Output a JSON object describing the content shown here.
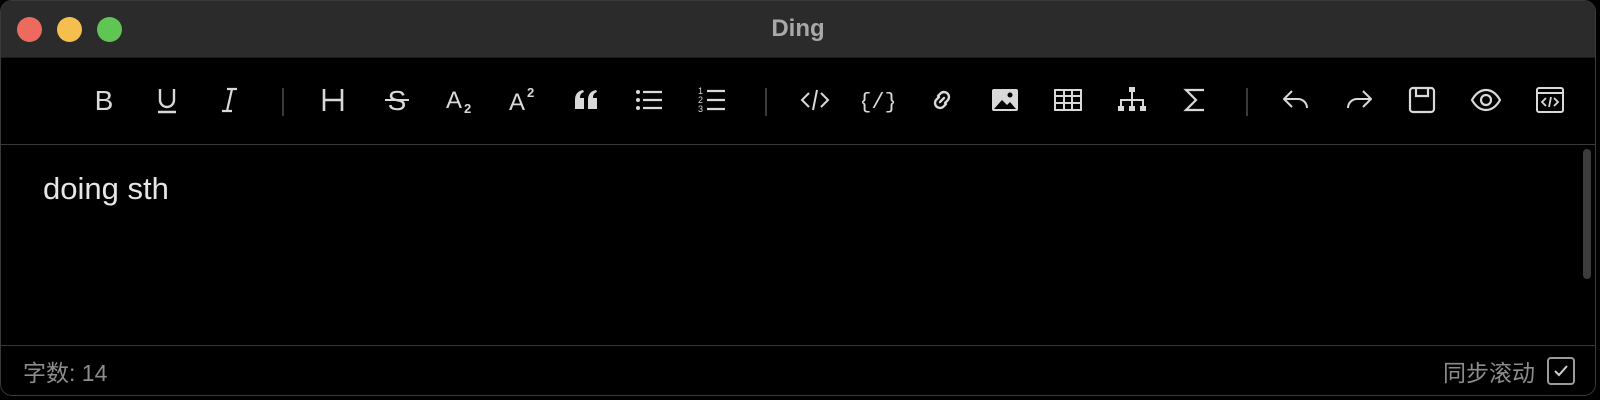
{
  "window": {
    "title": "Ding"
  },
  "toolbar": {
    "buttons": [
      {
        "name": "bold",
        "icon": "bold-icon"
      },
      {
        "name": "underline",
        "icon": "underline-icon"
      },
      {
        "name": "italic",
        "icon": "italic-icon"
      },
      {
        "name": "heading",
        "icon": "heading-icon"
      },
      {
        "name": "strikethrough",
        "icon": "strikethrough-icon"
      },
      {
        "name": "subscript",
        "icon": "subscript-icon"
      },
      {
        "name": "superscript",
        "icon": "superscript-icon"
      },
      {
        "name": "quote",
        "icon": "quote-icon"
      },
      {
        "name": "bullet-list",
        "icon": "bullet-list-icon"
      },
      {
        "name": "numbered-list",
        "icon": "numbered-list-icon"
      },
      {
        "name": "inline-code",
        "icon": "code-icon"
      },
      {
        "name": "code-block",
        "icon": "code-block-icon"
      },
      {
        "name": "link",
        "icon": "link-icon"
      },
      {
        "name": "image",
        "icon": "image-icon"
      },
      {
        "name": "table",
        "icon": "table-icon"
      },
      {
        "name": "diagram",
        "icon": "org-chart-icon"
      },
      {
        "name": "formula",
        "icon": "sigma-icon"
      },
      {
        "name": "undo",
        "icon": "undo-icon"
      },
      {
        "name": "redo",
        "icon": "redo-icon"
      },
      {
        "name": "save",
        "icon": "save-icon"
      },
      {
        "name": "preview",
        "icon": "eye-icon"
      },
      {
        "name": "source",
        "icon": "source-code-icon"
      }
    ]
  },
  "editor": {
    "content": "doing sth"
  },
  "status": {
    "word_count": "字数: 14",
    "sync_scroll_label": "同步滚动",
    "sync_scroll_checked": true
  },
  "colors": {
    "titlebar": "#2b2b2b",
    "background": "#000000",
    "icon": "#d9d9d9",
    "close": "#ed6a5e",
    "minimize": "#f5bf4f",
    "maximize": "#61c554"
  }
}
